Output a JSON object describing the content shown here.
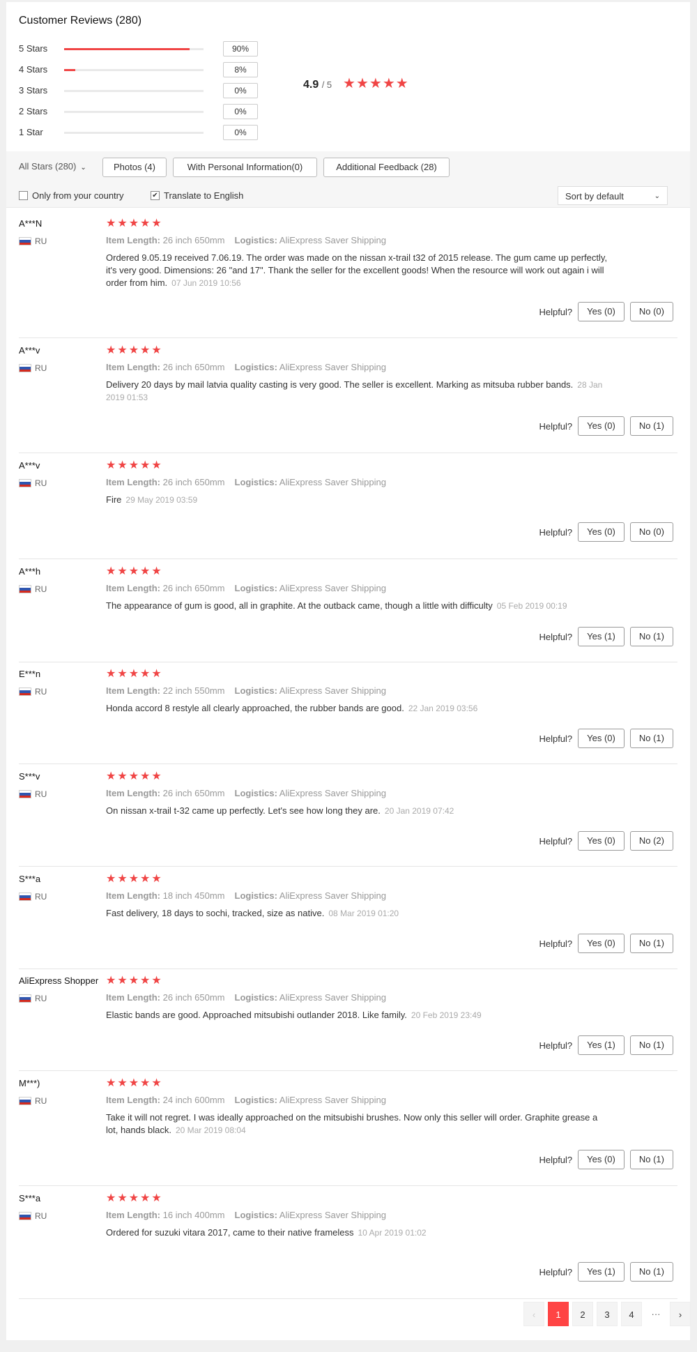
{
  "title": "Customer Reviews (280)",
  "distribution": [
    {
      "label": "5 Stars",
      "percent": 90,
      "pct_label": "90%"
    },
    {
      "label": "4 Stars",
      "percent": 8,
      "pct_label": "8%"
    },
    {
      "label": "3 Stars",
      "percent": 0,
      "pct_label": "0%"
    },
    {
      "label": "2 Stars",
      "percent": 0,
      "pct_label": "0%"
    },
    {
      "label": "1 Star",
      "percent": 0,
      "pct_label": "0%"
    }
  ],
  "average": {
    "value": "4.9",
    "out_of": "/ 5",
    "stars": 5
  },
  "accent_color": "#f04545",
  "filters": {
    "all_stars": "All Stars (280)",
    "photos": "Photos (4)",
    "personal_info": "With Personal Information(0)",
    "additional_feedback": "Additional Feedback (28)",
    "only_country": "Only from your country",
    "only_country_checked": false,
    "translate": "Translate to English",
    "translate_checked": true,
    "sort": "Sort by default"
  },
  "labels": {
    "item_length": "Item Length:",
    "logistics": "Logistics:",
    "helpful": "Helpful?"
  },
  "reviews": [
    {
      "user": "A***N",
      "country": "RU",
      "length": "26 inch 650mm",
      "shipping": "AliExpress Saver Shipping",
      "text": "Ordered 9.05.19 received 7.06.19. The order was made on the nissan x-trail t32 of 2015 release. The gum came up perfectly, it's very good. Dimensions: 26 \"and 17\". Thank the seller for the excellent goods! When the resource will work out again i will order from him.",
      "date": "07 Jun 2019 10:56",
      "yes": "Yes (0)",
      "no": "No (0)"
    },
    {
      "user": "A***v",
      "country": "RU",
      "length": "26 inch 650mm",
      "shipping": "AliExpress Saver Shipping",
      "text": "Delivery 20 days by mail latvia quality casting is very good. The seller is excellent. Marking as mitsuba rubber bands.",
      "date": "28 Jan 2019 01:53",
      "yes": "Yes (0)",
      "no": "No (1)"
    },
    {
      "user": "A***v",
      "country": "RU",
      "length": "26 inch 650mm",
      "shipping": "AliExpress Saver Shipping",
      "text": "Fire",
      "date": "29 May 2019 03:59",
      "yes": "Yes (0)",
      "no": "No (0)"
    },
    {
      "user": "A***h",
      "country": "RU",
      "length": "26 inch 650mm",
      "shipping": "AliExpress Saver Shipping",
      "text": "The appearance of gum is good, all in graphite. At the outback came, though a little with difficulty",
      "date": "05 Feb 2019 00:19",
      "yes": "Yes (1)",
      "no": "No (1)"
    },
    {
      "user": "E***n",
      "country": "RU",
      "length": "22 inch 550mm",
      "shipping": "AliExpress Saver Shipping",
      "text": "Honda accord 8 restyle all clearly approached, the rubber bands are good.",
      "date": "22 Jan 2019 03:56",
      "yes": "Yes (0)",
      "no": "No (1)"
    },
    {
      "user": "S***v",
      "country": "RU",
      "length": "26 inch 650mm",
      "shipping": "AliExpress Saver Shipping",
      "text": "On nissan x-trail t-32 came up perfectly. Let's see how long they are.",
      "date": "20 Jan 2019 07:42",
      "yes": "Yes (0)",
      "no": "No (2)"
    },
    {
      "user": "S***a",
      "country": "RU",
      "length": "18 inch 450mm",
      "shipping": "AliExpress Saver Shipping",
      "text": "Fast delivery, 18 days to sochi, tracked, size as native.",
      "date": "08 Mar 2019 01:20",
      "yes": "Yes (0)",
      "no": "No (1)"
    },
    {
      "user": "AliExpress Shopper",
      "country": "RU",
      "length": "26 inch 650mm",
      "shipping": "AliExpress Saver Shipping",
      "text": "Elastic bands are good. Approached mitsubishi outlander 2018. Like family.",
      "date": "20 Feb 2019 23:49",
      "yes": "Yes (1)",
      "no": "No (1)"
    },
    {
      "user": "M***)",
      "country": "RU",
      "length": "24 inch 600mm",
      "shipping": "AliExpress Saver Shipping",
      "text": "Take it will not regret. I was ideally approached on the mitsubishi brushes. Now only this seller will order. Graphite grease a lot, hands black.",
      "date": "20 Mar 2019 08:04",
      "yes": "Yes (0)",
      "no": "No (1)"
    },
    {
      "user": "S***a",
      "country": "RU",
      "length": "16 inch 400mm",
      "shipping": "AliExpress Saver Shipping",
      "text": "Ordered for suzuki vitara 2017, came to their native frameless",
      "date": "10 Apr 2019 01:02",
      "yes": "Yes (1)",
      "no": "No (1)"
    }
  ],
  "pagination": {
    "prev": "‹",
    "pages": [
      "1",
      "2",
      "3",
      "4"
    ],
    "current": "1",
    "ellipsis": "···",
    "next": "›"
  }
}
